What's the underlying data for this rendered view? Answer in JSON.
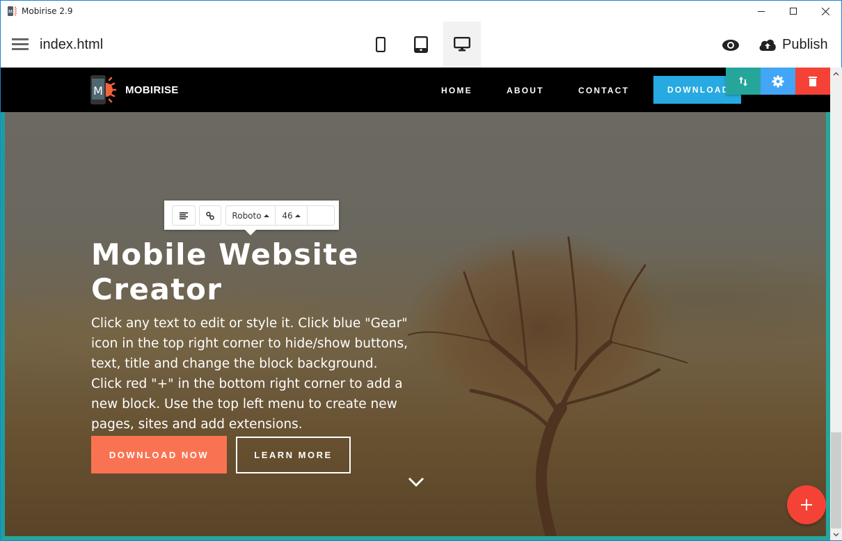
{
  "window": {
    "title": "Mobirise 2.9",
    "controls": {
      "minimize": "minimize",
      "maximize": "maximize",
      "close": "close"
    }
  },
  "toolbar": {
    "filename": "index.html",
    "devices": [
      {
        "name": "mobile",
        "icon": "mobile-icon",
        "active": false
      },
      {
        "name": "tablet",
        "icon": "tablet-icon",
        "active": false
      },
      {
        "name": "desktop",
        "icon": "desktop-icon",
        "active": true
      }
    ],
    "preview_icon": "eye-icon",
    "publish_label": "Publish"
  },
  "site": {
    "brand": "MOBIRISE",
    "logo_letter": "M",
    "nav": {
      "home": "HOME",
      "about": "ABOUT",
      "contact": "CONTACT",
      "download": "DOWNLOAD"
    },
    "block_tools": {
      "move": "move-icon",
      "settings": "gear-icon",
      "delete": "trash-icon"
    }
  },
  "editor_toolbar": {
    "font": "Roboto",
    "size": "46"
  },
  "hero": {
    "title": "Mobile Website Creator",
    "paragraph1": "Click any text to edit or style it. Click blue \"Gear\" icon in the top right corner to hide/show buttons, text, title and change the block background.",
    "paragraph2": "Click red \"+\" in the bottom right corner to add a new block. Use the top left menu to create new pages, sites and add extensions.",
    "primary_button": "DOWNLOAD NOW",
    "secondary_button": "LEARN MORE"
  },
  "colors": {
    "nav_download": "#27aae1",
    "primary_button": "#f97352",
    "move_tool": "#26a69a",
    "gear_tool": "#42a5f5",
    "delete_tool": "#f44336",
    "add_block": "#f44336",
    "block_outline": "#26a69a"
  }
}
